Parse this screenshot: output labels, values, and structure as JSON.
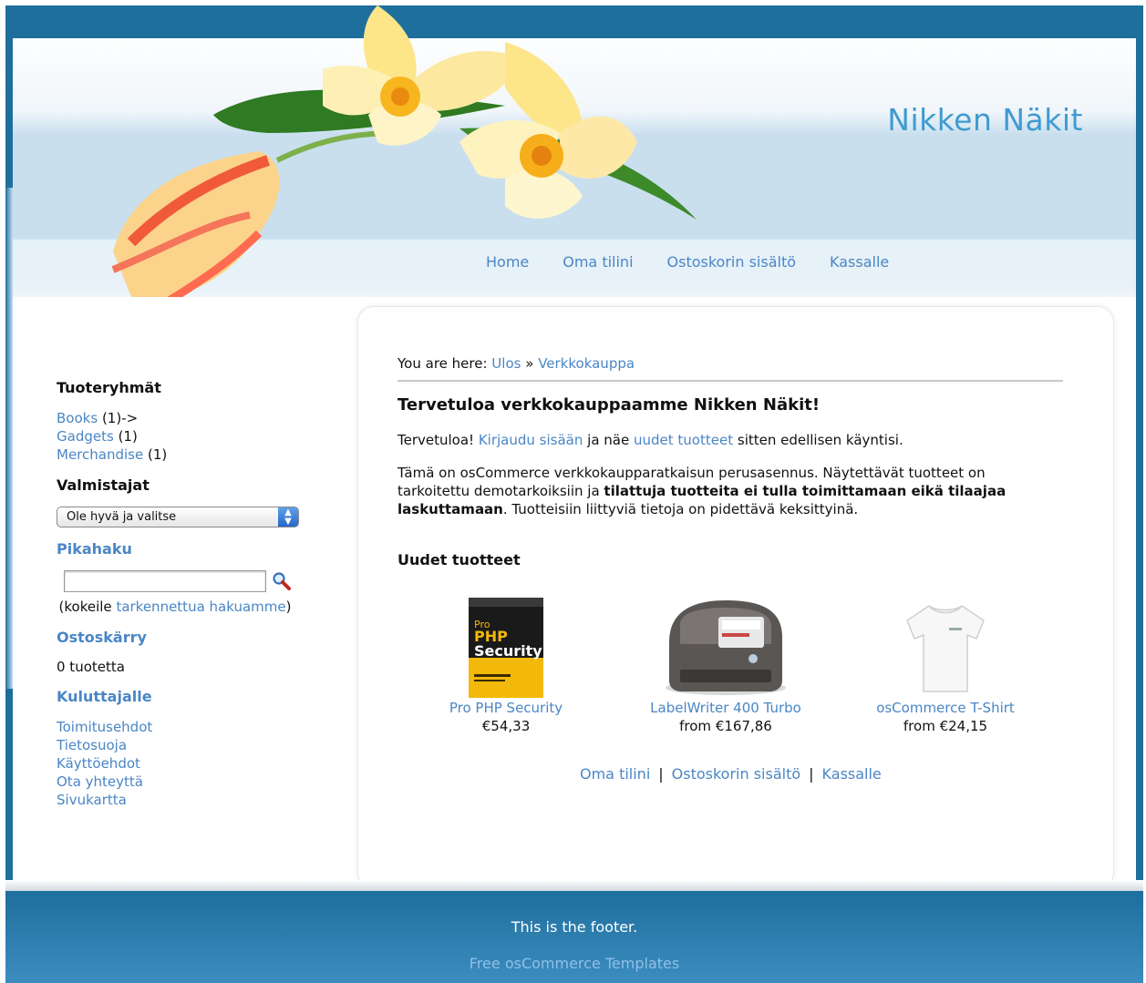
{
  "site": {
    "title": "Nikken Näkit"
  },
  "nav": {
    "items": [
      "Home",
      "Oma tilini",
      "Ostoskorin sisältö",
      "Kassalle"
    ]
  },
  "breadcrumb": {
    "prefix": "You are here:",
    "items": [
      "Ulos",
      "Verkkokauppa"
    ],
    "separator": "»"
  },
  "sidebar": {
    "categories": {
      "heading": "Tuoteryhmät",
      "items": [
        {
          "label": "Books",
          "suffix": "(1)->"
        },
        {
          "label": "Gadgets",
          "suffix": "(1)"
        },
        {
          "label": "Merchandise",
          "suffix": "(1)"
        }
      ]
    },
    "manufacturers": {
      "heading": "Valmistajat",
      "selected": "Ole hyvä ja valitse"
    },
    "quick_search": {
      "heading": "Pikahaku",
      "value": "",
      "hint_open": "(kokeile",
      "hint_link": "tarkennettua hakuamme",
      "hint_close": ")"
    },
    "cart": {
      "heading": "Ostoskärry",
      "text": "0 tuotetta"
    },
    "info": {
      "heading": "Kuluttajalle",
      "items": [
        "Toimitusehdot",
        "Tietosuoja",
        "Käyttöehdot",
        "Ota yhteyttä",
        "Sivukartta"
      ]
    }
  },
  "main": {
    "welcome_heading": "Tervetuloa verkkokauppaamme Nikken Näkit!",
    "greeting": {
      "t1": "Tervetuloa!",
      "login_link": "Kirjaudu sisään",
      "t2": "ja näe",
      "new_link": "uudet tuotteet",
      "t3": "sitten edellisen käyntisi."
    },
    "intro": {
      "t1": "Tämä on osCommerce verkkokaupparatkaisun perusasennus. Näytettävät tuotteet on tarkoitettu demotarkoiksiin ja",
      "bold": "tilattuja tuotteita ei tulla toimittamaan eikä tilaajaa laskuttamaan",
      "t2": ". Tuotteisiin liittyviä tietoja on pidettävä keksittyinä."
    },
    "new_products_heading": "Uudet tuotteet",
    "products": [
      {
        "name": "Pro PHP Security",
        "price": "€54,33",
        "image": "book-cover"
      },
      {
        "name": "LabelWriter 400 Turbo",
        "price": "from €167,86",
        "image": "label-printer"
      },
      {
        "name": "osCommerce T-Shirt",
        "price": "from €24,15",
        "image": "t-shirt"
      }
    ],
    "bottom_links": [
      "Oma tilini",
      "Ostoskorin sisältö",
      "Kassalle"
    ],
    "book_cover_text": [
      "Pro",
      "PHP",
      "Security"
    ]
  },
  "footer": {
    "text": "This is the footer.",
    "link": "Free osCommerce Templates"
  },
  "colors": {
    "link": "#4a86c5",
    "brand_blue": "#1e6f9c",
    "title": "#3f9bd0"
  }
}
